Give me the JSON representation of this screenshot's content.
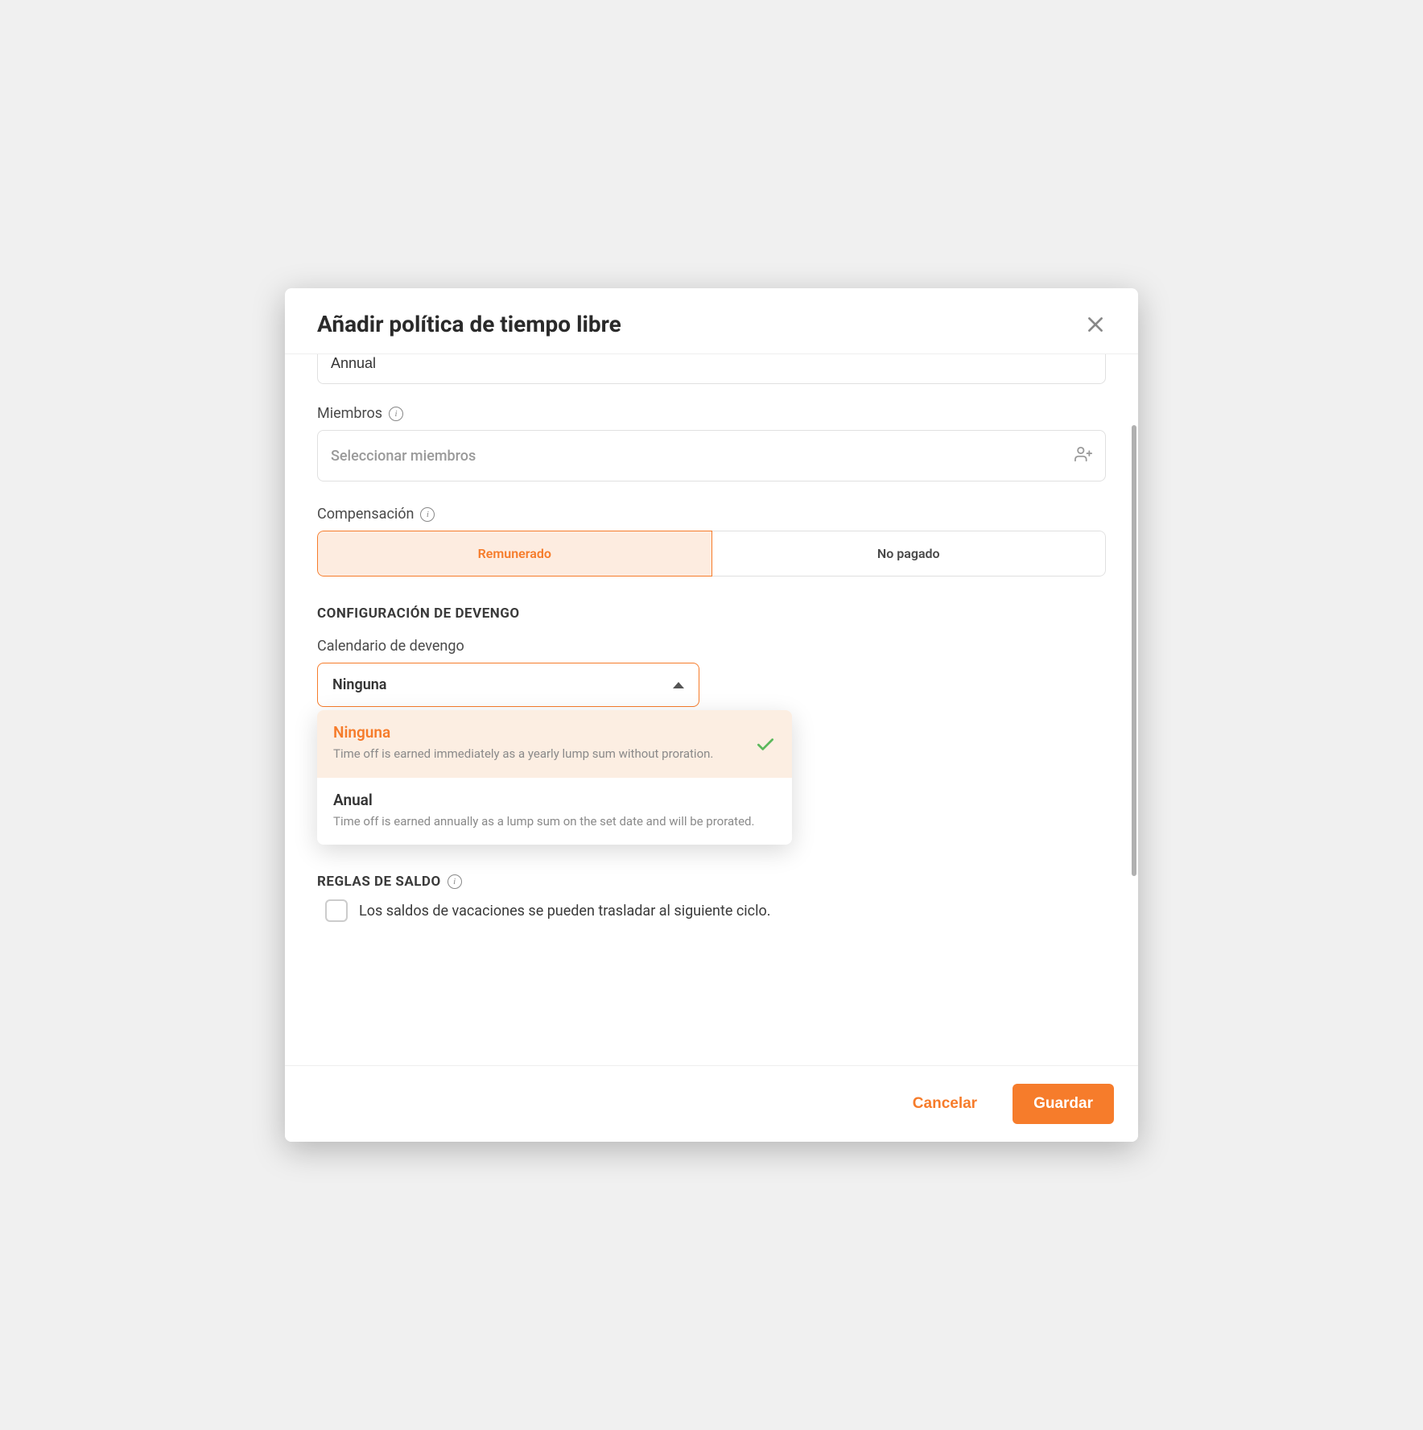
{
  "modal": {
    "title": "Añadir política de tiempo libre"
  },
  "name_input": {
    "value": "Annual"
  },
  "members": {
    "label": "Miembros",
    "placeholder": "Seleccionar miembros"
  },
  "compensation": {
    "label": "Compensación",
    "paid": "Remunerado",
    "unpaid": "No pagado"
  },
  "accrual": {
    "heading": "CONFIGURACIÓN DE DEVENGO",
    "calendar_label": "Calendario de devengo",
    "selected": "Ninguna",
    "options": [
      {
        "title": "Ninguna",
        "desc": "Time off is earned immediately as a yearly lump sum without proration."
      },
      {
        "title": "Anual",
        "desc": "Time off is earned annually as a lump sum on the set date and will be prorated."
      }
    ]
  },
  "balance": {
    "heading": "REGLAS DE SALDO",
    "carry_label": "Los saldos de vacaciones se pueden trasladar al siguiente ciclo."
  },
  "footer": {
    "cancel": "Cancelar",
    "save": "Guardar"
  }
}
